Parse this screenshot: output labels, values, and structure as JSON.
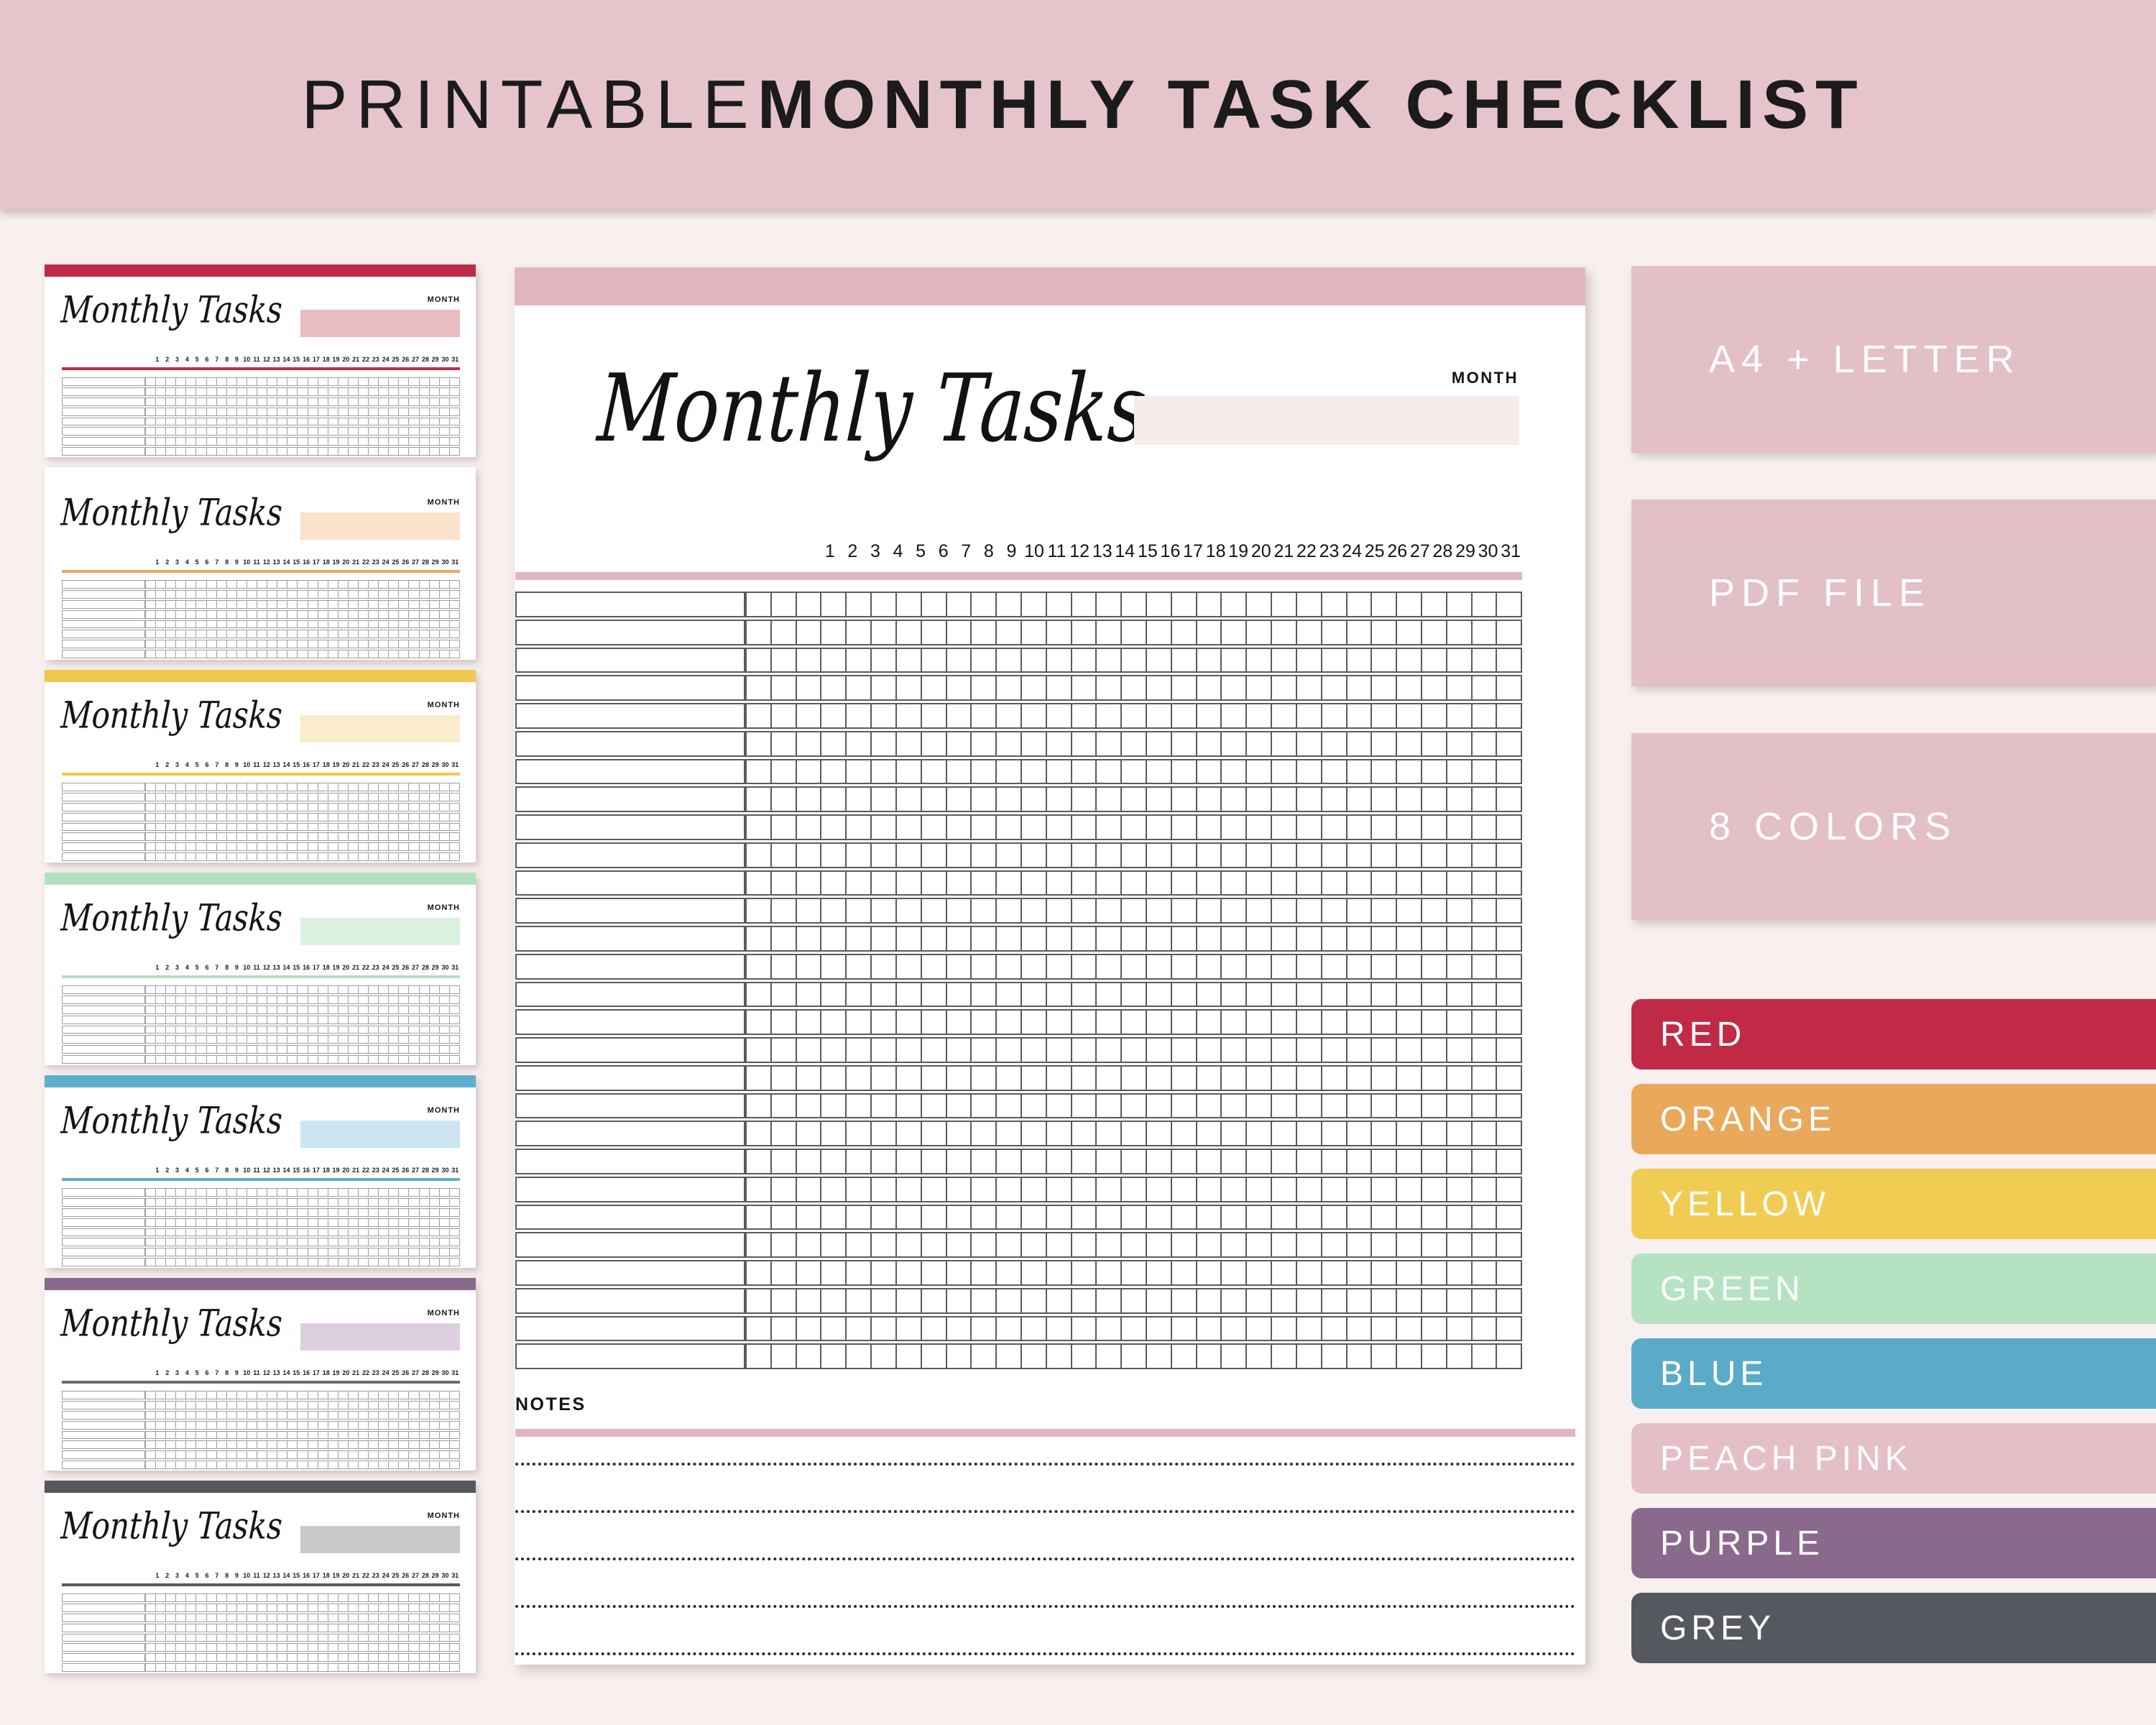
{
  "header": {
    "title_light": "PRINTABLE",
    "title_bold": "MONTHLY TASK CHECKLIST"
  },
  "page": {
    "background_color": "#f8f0ee",
    "banner_color": "#e6c4cb"
  },
  "document": {
    "accent_color": "#e0b7c0",
    "script_title": "Monthly Tasks",
    "month_label": "MONTH",
    "month_value": "",
    "month_box_color": "#f6eceb",
    "days": [
      "1",
      "2",
      "3",
      "4",
      "5",
      "6",
      "7",
      "8",
      "9",
      "10",
      "11",
      "12",
      "13",
      "14",
      "15",
      "16",
      "17",
      "18",
      "19",
      "20",
      "21",
      "22",
      "23",
      "24",
      "25",
      "26",
      "27",
      "28",
      "29",
      "30",
      "31"
    ],
    "grid_rows": 28,
    "grid_day_columns": 31,
    "notes_label": "NOTES",
    "notes_lines": 5
  },
  "thumbnails": [
    {
      "name": "red",
      "script_title": "Monthly Tasks",
      "month_label": "MONTH",
      "bar_color": "#be2b45",
      "rule_color": "#be2b45",
      "box_color": "#e8bcc0"
    },
    {
      "name": "orange",
      "script_title": "Monthly Tasks",
      "month_label": "MONTH",
      "bar_color": "#e9a košice",
      "rule_color": "#e9a95c",
      "box_color": "#f9e3cc"
    },
    {
      "name": "yellow",
      "script_title": "Monthly Tasks",
      "month_label": "MONTH",
      "bar_color": "#f0c84f",
      "rule_color": "#f0c84f",
      "box_color": "#fbeccb"
    },
    {
      "name": "green",
      "script_title": "Monthly Tasks",
      "month_label": "MONTH",
      "bar_color": "#b2e0bd",
      "rule_color": "#b2e0bd",
      "box_color": "#dbf1e0"
    },
    {
      "name": "blue",
      "script_title": "Monthly Tasks",
      "month_label": "MONTH",
      "bar_color": "#5eafcb",
      "rule_color": "#5eafcb",
      "box_color": "#cde5f0"
    },
    {
      "name": "purple",
      "script_title": "Monthly Tasks",
      "month_label": "MONTH",
      "bar_color": "#8a6a8c",
      "rule_color": "#6d6d6d",
      "box_color": "#ddd0de"
    },
    {
      "name": "grey",
      "script_title": "Monthly Tasks",
      "month_label": "MONTH",
      "bar_color": "#55585f",
      "rule_color": "#55585f",
      "box_color": "#c9c9c9"
    }
  ],
  "badges": [
    {
      "label": "A4 + LETTER",
      "color": "#e3bfc7"
    },
    {
      "label": "PDF FILE",
      "color": "#e3bfc7"
    },
    {
      "label": "8 COLORS",
      "color": "#e3bfc7"
    }
  ],
  "color_swatches": [
    {
      "label": "RED",
      "color": "#c02a46"
    },
    {
      "label": "ORANGE",
      "color": "#eaa85b"
    },
    {
      "label": "YELLOW",
      "color": "#f0cc53"
    },
    {
      "label": "GREEN",
      "color": "#b5e2c2"
    },
    {
      "label": "BLUE",
      "color": "#59abc8"
    },
    {
      "label": "PEACH PINK",
      "color": "#e5bfc8"
    },
    {
      "label": "PURPLE",
      "color": "#8a6a8c"
    },
    {
      "label": "GREY",
      "color": "#56585f"
    }
  ]
}
